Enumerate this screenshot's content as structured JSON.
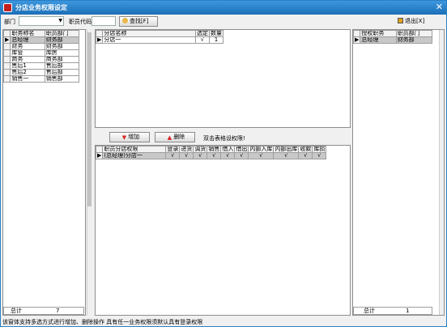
{
  "window": {
    "title": "分店业务权限设定"
  },
  "toolbar": {
    "dept_label": "部门",
    "code_label": "职员代码",
    "search_label": "查找[F]",
    "exit_label": "退出[X]"
  },
  "left_table": {
    "headers": [
      "职务称名",
      "职员部门"
    ],
    "rows": [
      [
        "总经理",
        "财务部"
      ],
      [
        "财务",
        "财务部"
      ],
      [
        "库管",
        "库房"
      ],
      [
        "商务",
        "商务部"
      ],
      [
        "售后1",
        "售后部"
      ],
      [
        "售后2",
        "售后部"
      ],
      [
        "销售一",
        "销售部"
      ]
    ],
    "footer_label": "总计",
    "footer_value": "7"
  },
  "store_table": {
    "headers": [
      "分店名称",
      "选定",
      "数量"
    ],
    "rows": [
      [
        "分店一",
        "√",
        "1"
      ]
    ]
  },
  "actions": {
    "add_label": "增加",
    "delete_label": "删除",
    "hint": "双击表格设权限!"
  },
  "perm_table": {
    "headers": [
      "职员分店权限",
      "登录",
      "进货",
      "调货",
      "销售",
      "借入",
      "借出",
      "内部入库",
      "内部出库",
      "收款",
      "库损"
    ],
    "rows": [
      [
        "(总经理)分店一",
        "√",
        "√",
        "√",
        "√",
        "√",
        "√",
        "√",
        "√",
        "√",
        "√"
      ]
    ]
  },
  "right_table": {
    "headers": [
      "授权职务",
      "职员部门"
    ],
    "rows": [
      [
        "总经理",
        "财务部"
      ]
    ],
    "footer_label": "总计",
    "footer_value": "1"
  },
  "status": {
    "text": "该窗体支持多选方式进行增加、删除操作      具有任一业务权限须默认具有登录权限"
  }
}
